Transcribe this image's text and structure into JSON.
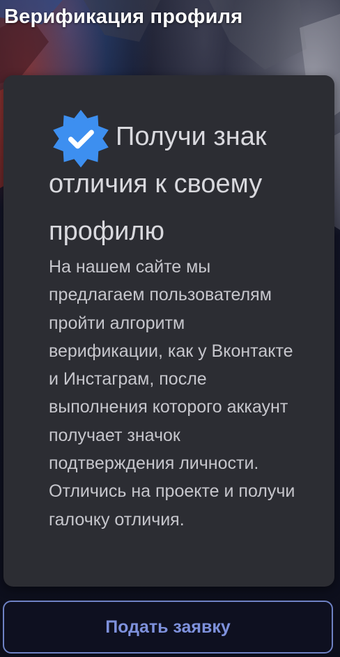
{
  "header": {
    "title": "Верификация профиля"
  },
  "card": {
    "icon": "verified-badge-icon",
    "heading": "Получи знак отличия к своему профилю",
    "description": "На нашем сайте мы предлагаем пользователям пройти алгоритм верификации, как у Вконтакте и Инстаграм, после выполнения которого аккаунт получает значок подтверждения личности. Отличись на проекте и получи галочку отличия."
  },
  "actions": {
    "apply_label": "Подать заявку"
  },
  "colors": {
    "badge": "#3d8ff0",
    "card_background": "#2c2d33",
    "button_accent": "#7e91dc"
  }
}
